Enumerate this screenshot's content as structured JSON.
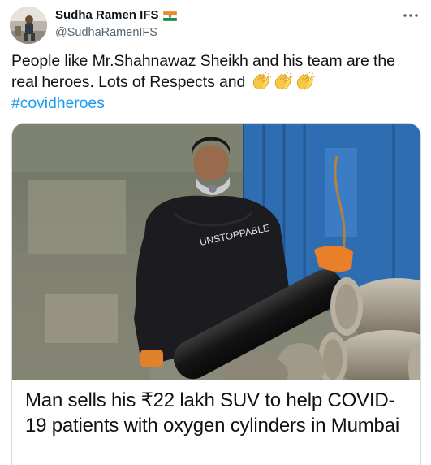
{
  "tweet": {
    "author": {
      "display_name": "Sudha Ramen IFS",
      "handle": "@SudhaRamenIFS",
      "flag_icon": "india-flag-icon",
      "avatar_icon": "avatar"
    },
    "text_main": "People like Mr.Shahnawaz Sheikh and his team are the real heroes. Lots of Respects and",
    "emoji": [
      "clapping-hands-icon",
      "clapping-hands-icon",
      "clapping-hands-icon"
    ],
    "hashtag": "#covidheroes",
    "more_icon": "more-icon",
    "media": {
      "headline": "Man sells his ₹22 lakh SUV to help COVID-19 patients with oxygen cylinders in Mumbai"
    }
  },
  "colors": {
    "link": "#1d9bf0",
    "text": "#0f1419",
    "secondary": "#536471",
    "border": "#cfd9de"
  }
}
